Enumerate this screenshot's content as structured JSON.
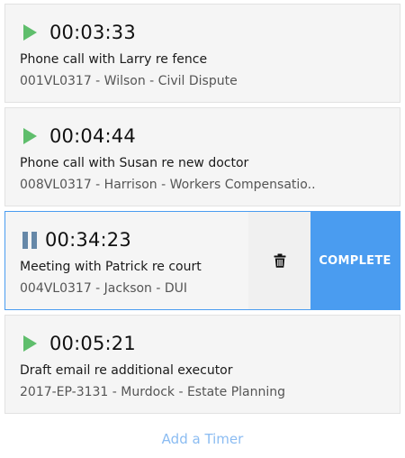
{
  "timers": [
    {
      "state": "paused",
      "time": "00:03:33",
      "title": "Phone call with Larry re fence",
      "matter": "001VL0317 - Wilson - Civil Dispute"
    },
    {
      "state": "paused",
      "time": "00:04:44",
      "title": "Phone call with Susan re new doctor",
      "matter": "008VL0317 - Harrison - Workers Compensatio.."
    },
    {
      "state": "running",
      "time": "00:34:23",
      "title": "Meeting with Patrick re court",
      "matter": "004VL0317 - Jackson - DUI",
      "complete_label": "COMPLETE",
      "delete_icon": "trash-icon"
    },
    {
      "state": "paused",
      "time": "00:05:21",
      "title": "Draft email re additional executor",
      "matter": "2017-EP-3131 - Murdock - Estate Planning"
    }
  ],
  "add_timer_label": "Add a Timer",
  "colors": {
    "play_green": "#5fbe6c",
    "pause_blue": "#6688a8",
    "accent_blue": "#4a9cf0",
    "link_blue": "#8bbcf2",
    "card_bg": "#f5f5f5"
  },
  "icons": {
    "start": "play-icon",
    "stop": "pause-icon",
    "delete": "trash-icon"
  }
}
